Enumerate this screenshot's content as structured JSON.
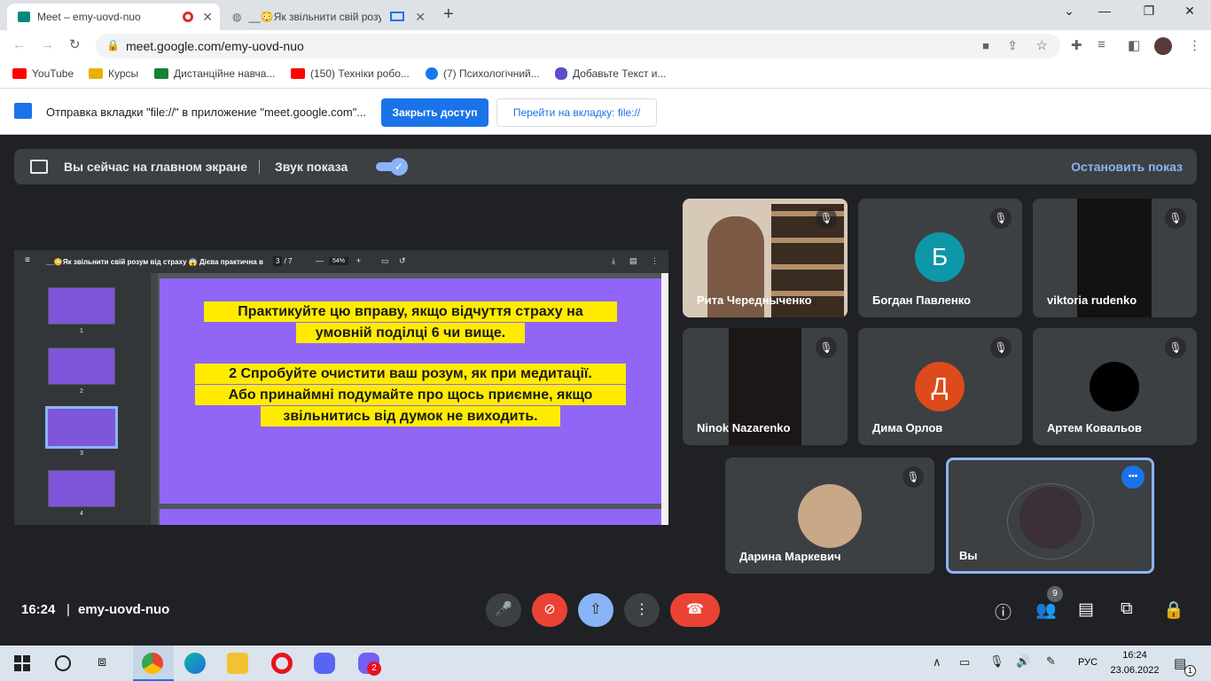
{
  "browser": {
    "tabs": [
      {
        "title": "Meet – emy-uovd-nuo",
        "active": true
      },
      {
        "title": "__😳Як звільнити свій розу",
        "active": false
      }
    ],
    "new_tab": "+",
    "url": "meet.google.com/emy-uovd-nuo",
    "bookmarks": [
      "YouTube",
      "Курсы",
      "Дистанційне навча...",
      "(150) Техніки робо...",
      "(7) Психологічний...",
      "Добавьте Текст и..."
    ],
    "infobar": {
      "message": "Отправка вкладки \"file://\" в приложение \"meet.google.com\"...",
      "primary_button": "Закрыть доступ",
      "secondary_button": "Перейти на вкладку: file://"
    }
  },
  "meet": {
    "share_banner": {
      "presenting": "Вы сейчас на главном экране",
      "audio": "Звук показа",
      "stop": "Остановить показ"
    },
    "presentation": {
      "doc_title": "__😳Як звільнити свій розум від страху 😱 Дієва практична вправ...",
      "page": "3",
      "pages_total": "/ 7",
      "zoom": "54%",
      "thumbs": [
        "1",
        "2",
        "3",
        "4"
      ],
      "line1": "Практикуйте цю вправу, якщо відчуття страху на",
      "line2": "умовній поділці 6 чи вище.",
      "line3": "2  Спробуйте очистити ваш розум, як при медитації.",
      "line4": "Або принаймні подумайте про щось приємне, якщо",
      "line5": "звільнитись від думок не виходить."
    },
    "participants": [
      {
        "name": "Рита Чередныченко",
        "initial": "",
        "color": "#d7c9b8"
      },
      {
        "name": "Богдан Павленко",
        "initial": "Б",
        "color": "#0e97a8"
      },
      {
        "name": "viktoria rudenko",
        "initial": "",
        "color": "#121212"
      },
      {
        "name": "Ninok Nazarenko",
        "initial": "",
        "color": "#1b1717"
      },
      {
        "name": "Дима Орлов",
        "initial": "Д",
        "color": "#dd4a1b"
      },
      {
        "name": "Артем Ковальов",
        "initial": "",
        "color": "#000000"
      },
      {
        "name": "Дарина Маркевич",
        "initial": "",
        "color": "#c9a887"
      },
      {
        "name": "Вы",
        "initial": "",
        "color": "#3b2f3a"
      }
    ],
    "clock": "16:24",
    "meeting_code": "emy-uovd-nuo",
    "participant_count": "9",
    "more_button": "•••"
  },
  "taskbar": {
    "language": "РУС",
    "time": "16:24",
    "date": "23.06.2022",
    "viber_badge": "2",
    "notif_badge": "1"
  }
}
